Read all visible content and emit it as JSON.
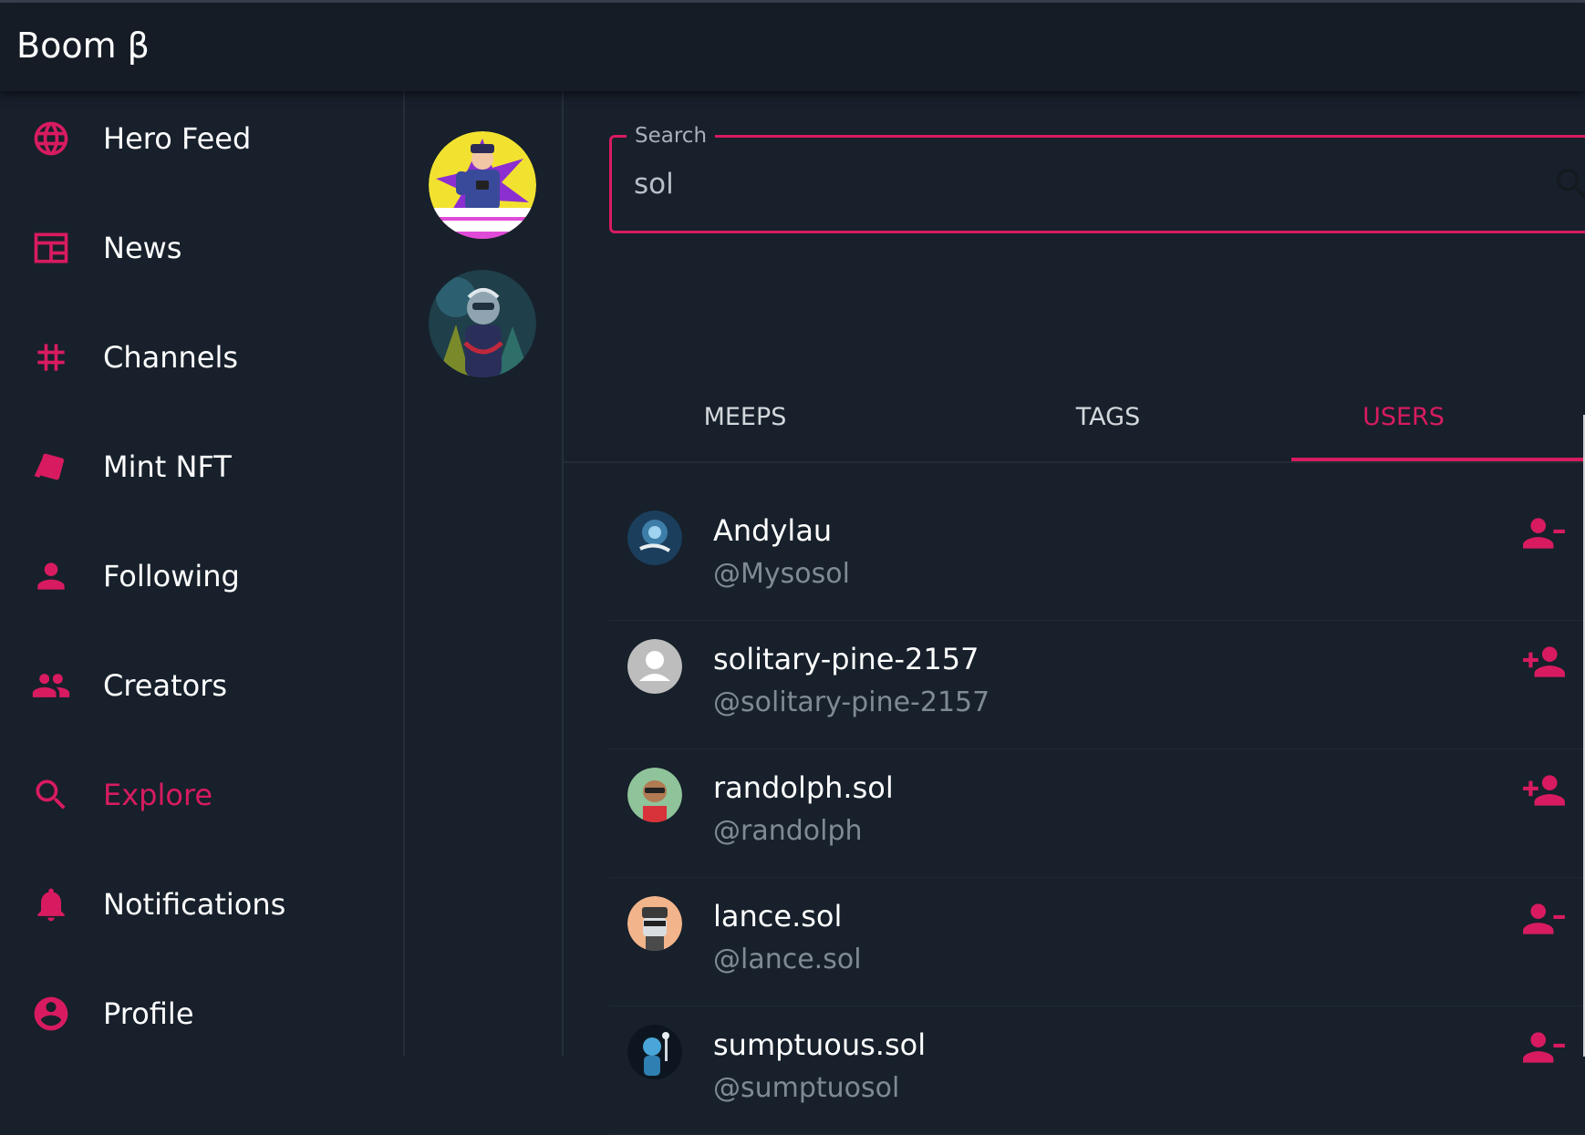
{
  "app": {
    "title": "Boom β"
  },
  "colors": {
    "accent": "#d81b60",
    "background": "#17202b",
    "appbar": "#151c25",
    "muted_text": "#808a95"
  },
  "sidebar": {
    "items": [
      {
        "label": "Hero Feed",
        "icon": "globe-icon",
        "active": false
      },
      {
        "label": "News",
        "icon": "newspaper-icon",
        "active": false
      },
      {
        "label": "Channels",
        "icon": "hashtag-icon",
        "active": false
      },
      {
        "label": "Mint NFT",
        "icon": "tag-cards-icon",
        "active": false
      },
      {
        "label": "Following",
        "icon": "person-icon",
        "active": false
      },
      {
        "label": "Creators",
        "icon": "people-icon",
        "active": false
      },
      {
        "label": "Explore",
        "icon": "search-icon",
        "active": true
      },
      {
        "label": "Notifications",
        "icon": "bell-icon",
        "active": false
      },
      {
        "label": "Profile",
        "icon": "account-circle-icon",
        "active": false
      }
    ]
  },
  "rail": {
    "avatars": [
      {
        "name": "comic-avatar"
      },
      {
        "name": "hero-avatar"
      }
    ]
  },
  "search": {
    "label": "Search",
    "value": "sol",
    "icon": "search-icon"
  },
  "tabs": [
    {
      "label": "MEEPS",
      "active": false
    },
    {
      "label": "TAGS",
      "active": false
    },
    {
      "label": "USERS",
      "active": true
    }
  ],
  "users": [
    {
      "name": "Andylau",
      "handle": "@Mysosol",
      "following": true,
      "action_icon": "person-remove-icon"
    },
    {
      "name": "solitary-pine-2157",
      "handle": "@solitary-pine-2157",
      "following": false,
      "action_icon": "person-add-icon"
    },
    {
      "name": "randolph.sol",
      "handle": "@randolph",
      "following": false,
      "action_icon": "person-add-icon"
    },
    {
      "name": "lance.sol",
      "handle": "@lance.sol",
      "following": true,
      "action_icon": "person-remove-icon"
    },
    {
      "name": "sumptuous.sol",
      "handle": "@sumptuosol",
      "following": true,
      "action_icon": "person-remove-icon"
    }
  ]
}
